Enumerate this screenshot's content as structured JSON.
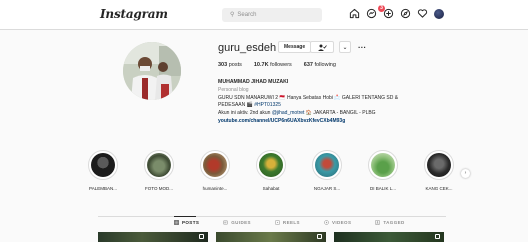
{
  "header": {
    "logo": "Instagram",
    "search_placeholder": "Search",
    "notification_count": "3",
    "icons": [
      "home-icon",
      "messenger-icon",
      "new-post-icon",
      "explore-icon",
      "activity-heart-icon",
      "profile-avatar"
    ]
  },
  "profile": {
    "username": "guru_esdeh",
    "message_label": "Message",
    "more_label": "...",
    "stats": {
      "posts_count": "303",
      "posts_label": "posts",
      "followers_count": "10.7K",
      "followers_label": "followers",
      "following_count": "637",
      "following_label": "following"
    },
    "bio": {
      "name": "MUHAMMAD JIHAD MUZAKI",
      "category": "Personal blog",
      "line1": "GURU SDN MANARUWI 2 🇲🇨 Hanya Sebatas Hobi 📩 GALERI TENTANG SD &",
      "line2_prefix": "PEDESAAN 🎬 ",
      "line2_tag": "#HPT01325",
      "line3_prefix": "Akun ini aktiv. 2nd akun ",
      "line3_mention": "@jihad_motret",
      "line3_suffix": " 🏠 JAKARTA - BANGIL - PLBG",
      "link": "youtube.com/channel/UCP6n6UAXbvzKfevCXb4M93g"
    }
  },
  "highlights": [
    {
      "label": "PALEMBAN..."
    },
    {
      "label": "FOTO MOD..."
    },
    {
      "label": "humaninte..."
    },
    {
      "label": "Sahabat"
    },
    {
      "label": "NGAJAR S..."
    },
    {
      "label": "DI BALIK L..."
    },
    {
      "label": "KANG CEK..."
    }
  ],
  "tabs": [
    {
      "label": "POSTS",
      "active": true,
      "icon": "grid-icon"
    },
    {
      "label": "GUIDES",
      "active": false,
      "icon": "guides-icon"
    },
    {
      "label": "REELS",
      "active": false,
      "icon": "reels-icon"
    },
    {
      "label": "VIDEOS",
      "active": false,
      "icon": "video-icon"
    },
    {
      "label": "TAGGED",
      "active": false,
      "icon": "tagged-icon"
    }
  ],
  "colors": {
    "background": "#fafafa",
    "border": "#dbdbdb",
    "link": "#00376b",
    "badge": "#ed4956"
  }
}
